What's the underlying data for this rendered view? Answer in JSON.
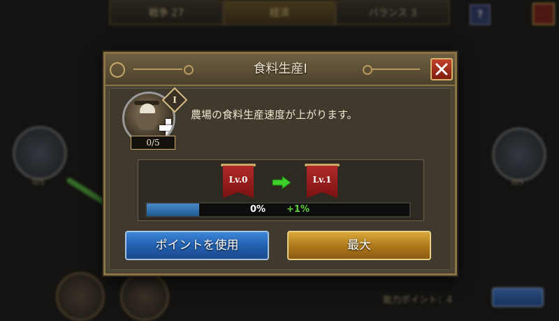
{
  "background": {
    "tabs": [
      {
        "label": "戦争 27"
      },
      {
        "label": "経済"
      },
      {
        "label": "バランス 3"
      }
    ],
    "ability_points_label": "能力ポイント：4",
    "node_counts": [
      "0/5",
      "0/5"
    ]
  },
  "dialog": {
    "title": "食料生産I",
    "tier": "I",
    "points": "0/5",
    "description": "農場の食料生産速度が上がります。",
    "current_level": "Lv.0",
    "next_level": "Lv.1",
    "progress": {
      "value_percent": 0,
      "label": "0%",
      "gain": "+1%"
    },
    "use_point_label": "ポイントを使用",
    "max_label": "最大"
  },
  "colors": {
    "accent_blue": "#2360b0",
    "accent_gold": "#b07a1c",
    "gain_green": "#5ed13a",
    "banner_red": "#9a1c1c"
  },
  "icons": [
    "close-icon",
    "farmer-icon",
    "plus-icon",
    "arrow-right-icon"
  ]
}
